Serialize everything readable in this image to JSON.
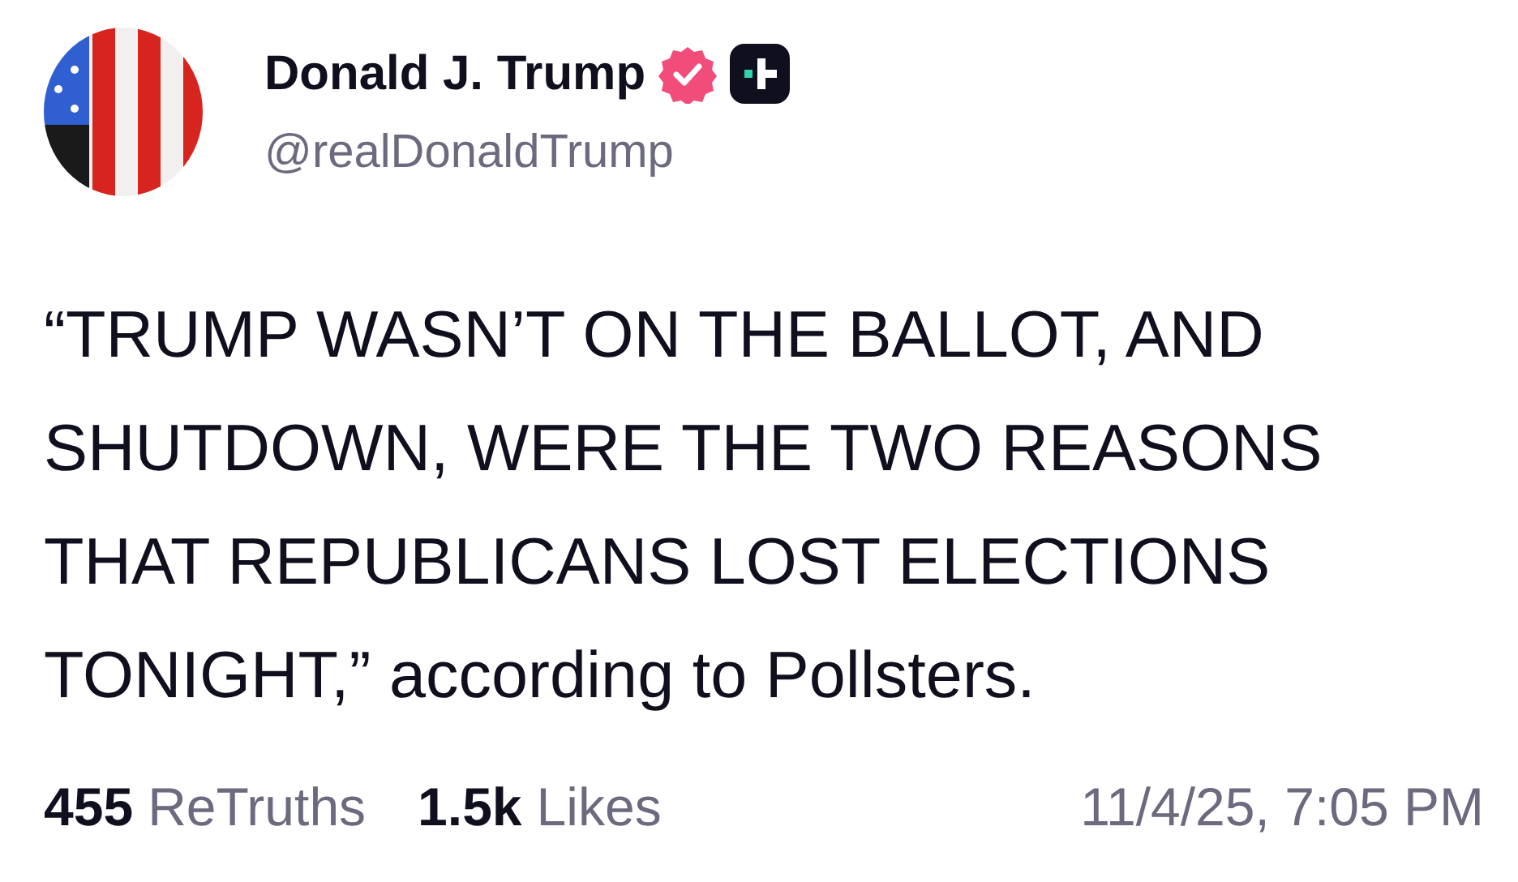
{
  "post": {
    "author": {
      "name": "Donald J. Trump",
      "handle": "@realDonaldTrump",
      "verified": true
    },
    "text": "“TRUMP WASN’T ON THE BALLOT, AND SHUTDOWN, WERE THE TWO REASONS THAT REPUBLICANS LOST ELECTIONS TONIGHT,” according to Pollsters.",
    "stats": [
      {
        "count": "455",
        "label": "ReTruths"
      },
      {
        "count": "1.5k",
        "label": "Likes"
      }
    ],
    "timestamp": "11/4/25, 7:05 PM"
  }
}
